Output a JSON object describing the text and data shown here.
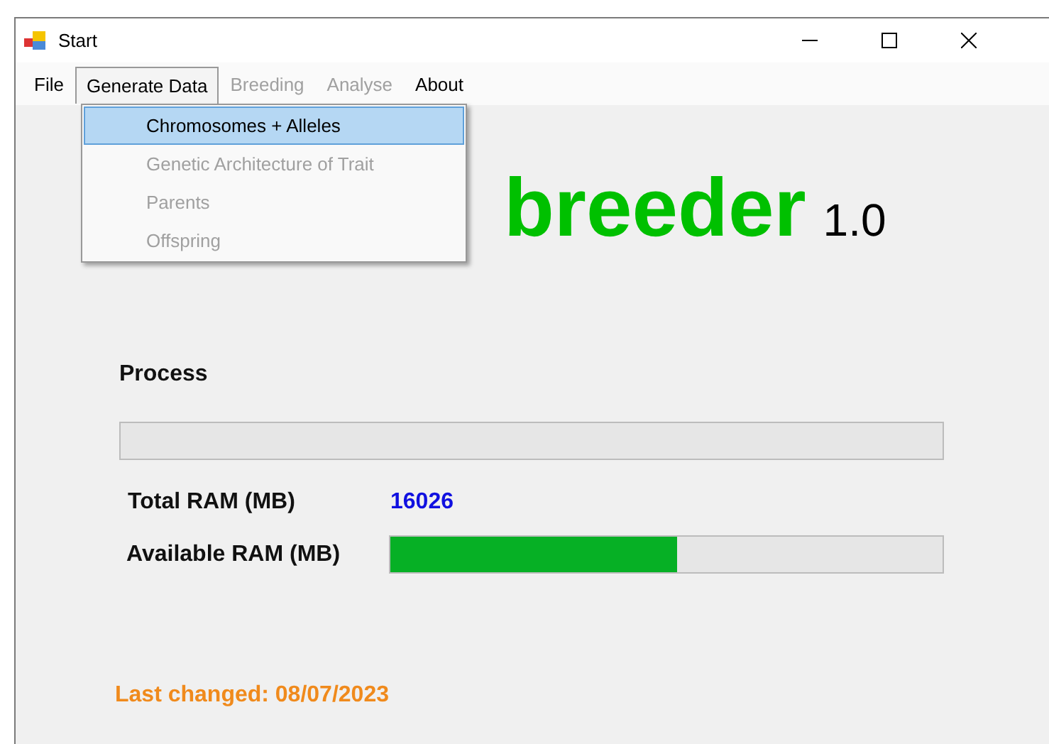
{
  "window": {
    "title": "Start"
  },
  "menu": [
    {
      "label": "File",
      "disabled": false,
      "selected": false
    },
    {
      "label": "Generate Data",
      "disabled": false,
      "selected": true
    },
    {
      "label": "Breeding",
      "disabled": true,
      "selected": false
    },
    {
      "label": "Analyse",
      "disabled": true,
      "selected": false
    },
    {
      "label": "About",
      "disabled": false,
      "selected": false
    }
  ],
  "dropdown": [
    {
      "label": "Chromosomes + Alleles",
      "disabled": false,
      "selected": true
    },
    {
      "label": "Genetic Architecture of Trait",
      "disabled": true,
      "selected": false
    },
    {
      "label": "Parents",
      "disabled": true,
      "selected": false
    },
    {
      "label": "Offspring",
      "disabled": true,
      "selected": false
    }
  ],
  "app_title": {
    "name": "breeder",
    "version": "1.0"
  },
  "process": {
    "label": "Process",
    "level": 0
  },
  "total_ram": {
    "label": "Total RAM (MB)",
    "value": "16026"
  },
  "available_ram": {
    "label": "Available RAM (MB)",
    "level": 0.52
  },
  "last_changed": "Last changed: 08/07/2023"
}
